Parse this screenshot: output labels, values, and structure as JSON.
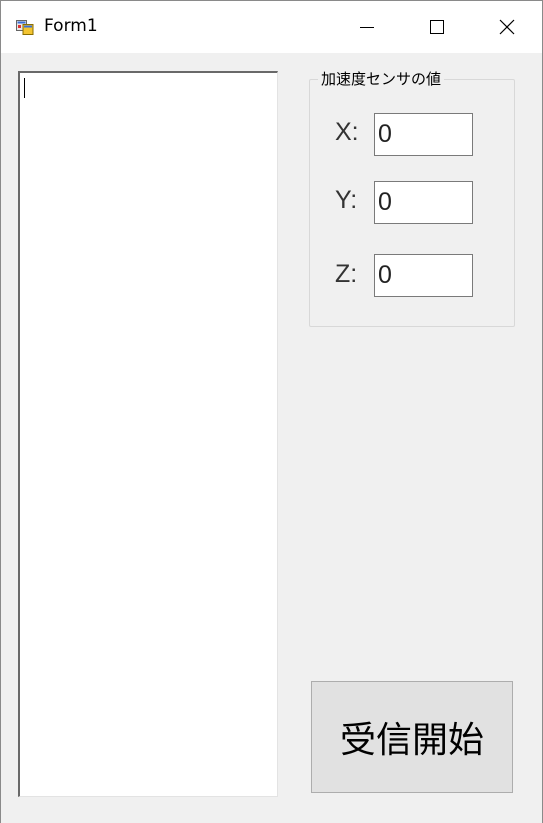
{
  "window": {
    "title": "Form1"
  },
  "group": {
    "caption": "加速度センサの値"
  },
  "axes": [
    {
      "label": "X:",
      "value": "0"
    },
    {
      "label": "Y:",
      "value": "0"
    },
    {
      "label": "Z:",
      "value": "0"
    }
  ],
  "log": {
    "value": ""
  },
  "buttons": {
    "start_label": "受信開始"
  },
  "icons": {
    "app": "form-app-icon",
    "minimize": "minimize-icon",
    "maximize": "maximize-icon",
    "close": "close-icon"
  }
}
